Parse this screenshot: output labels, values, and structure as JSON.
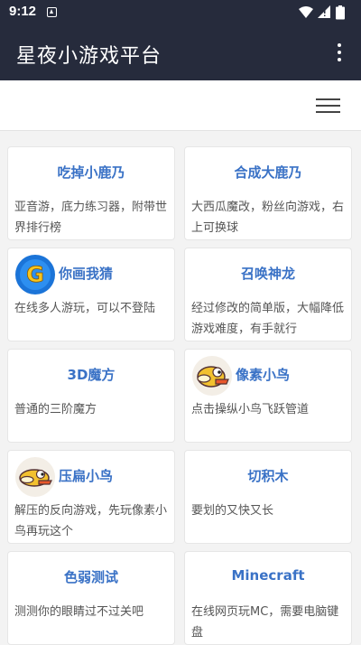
{
  "status_bar": {
    "time": "9:12",
    "notification_icon": "app-notification-icon",
    "icons": [
      "wifi-icon",
      "signal-icon",
      "battery-icon"
    ]
  },
  "app_bar": {
    "title": "星夜小游戏平台",
    "menu_icon": "more-vert-icon"
  },
  "nav": {
    "menu_icon": "hamburger-icon"
  },
  "colors": {
    "bar": "#262b3c",
    "link": "#3a72c6",
    "text": "#555555",
    "background": "#f3f3f3"
  },
  "games": [
    {
      "title": "吃掉小鹿乃",
      "desc": "亚音游，底力练习器，附带世界排行榜",
      "icon": ""
    },
    {
      "title": "合成大鹿乃",
      "desc": "大西瓜魔改，粉丝向游戏，右上可换球",
      "icon": ""
    },
    {
      "title": "你画我猜",
      "desc": "在线多人游玩，可以不登陆",
      "icon": "g-logo-icon"
    },
    {
      "title": "召唤神龙",
      "desc": "经过修改的简单版，大幅降低游戏难度，有手就行",
      "icon": ""
    },
    {
      "title": "3D魔方",
      "desc": "普通的三阶魔方",
      "icon": ""
    },
    {
      "title": "像素小鸟",
      "desc": "点击操纵小鸟飞跃管道",
      "icon": "flappy-bird-icon"
    },
    {
      "title": "压扁小鸟",
      "desc": "解压的反向游戏，先玩像素小鸟再玩这个",
      "icon": "flappy-bird-icon"
    },
    {
      "title": "切积木",
      "desc": "要划的又快又长",
      "icon": ""
    },
    {
      "title": "色弱测试",
      "desc": "测测你的眼睛过不过关吧",
      "icon": ""
    },
    {
      "title": "Minecraft",
      "desc": "在线网页玩MC，需要电脑键盘",
      "icon": ""
    }
  ]
}
